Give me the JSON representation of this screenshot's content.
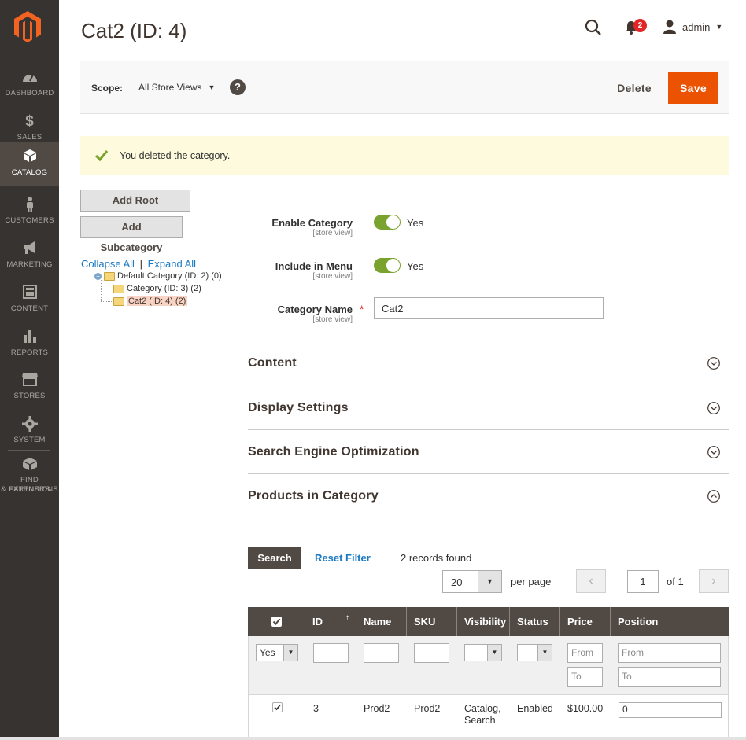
{
  "sidebar": {
    "items": [
      {
        "label": "DASHBOARD",
        "icon": "dashboard-icon"
      },
      {
        "label": "SALES",
        "icon": "dollar-icon"
      },
      {
        "label": "CATALOG",
        "icon": "cube-icon",
        "active": true
      },
      {
        "label": "CUSTOMERS",
        "icon": "person-icon"
      },
      {
        "label": "MARKETING",
        "icon": "megaphone-icon"
      },
      {
        "label": "CONTENT",
        "icon": "content-icon"
      },
      {
        "label": "REPORTS",
        "icon": "bar-chart-icon"
      },
      {
        "label": "STORES",
        "icon": "store-icon"
      },
      {
        "label": "SYSTEM",
        "icon": "gear-icon"
      }
    ],
    "partners_line1": "FIND PARTNERS",
    "partners_line2": "& EXTENSIONS"
  },
  "header": {
    "title": "Cat2 (ID: 4)",
    "notification_count": "2",
    "user_name": "admin"
  },
  "scope": {
    "label": "Scope:",
    "value": "All Store Views",
    "help": "?",
    "delete_label": "Delete",
    "save_label": "Save"
  },
  "message": {
    "text": "You deleted the category."
  },
  "tree": {
    "add_root": "Add Root Category",
    "add_sub": "Add Subcategory",
    "collapse_all": "Collapse All",
    "separator": "|",
    "expand_all": "Expand All",
    "nodes": [
      "Default Category (ID: 2) (0)",
      "Category (ID: 3) (2)",
      "Cat2 (ID: 4) (2)"
    ]
  },
  "form": {
    "enable_label": "Enable Category",
    "enable_scope": "[store view]",
    "enable_value": "Yes",
    "menu_label": "Include in Menu",
    "menu_scope": "[store view]",
    "menu_value": "Yes",
    "name_label": "Category Name",
    "name_scope": "[store view]",
    "name_required": "*",
    "name_value": "Cat2"
  },
  "sections": [
    {
      "title": "Content",
      "expanded": false
    },
    {
      "title": "Display Settings",
      "expanded": false
    },
    {
      "title": "Search Engine Optimization",
      "expanded": false
    },
    {
      "title": "Products in Category",
      "expanded": true
    }
  ],
  "grid": {
    "search_label": "Search",
    "reset_label": "Reset Filter",
    "records": "2 records found",
    "per_page_value": "20",
    "per_page_label": "per page",
    "page_value": "1",
    "page_of": "of 1",
    "columns": [
      "ID",
      "Name",
      "SKU",
      "Visibility",
      "Status",
      "Price",
      "Position"
    ],
    "filters": {
      "in_category": "Yes",
      "price_from": "From",
      "price_to": "To",
      "pos_from": "From",
      "pos_to": "To"
    },
    "rows": [
      {
        "id": "3",
        "name": "Prod2",
        "sku": "Prod2",
        "visibility_1": "Catalog,",
        "visibility_2": "Search",
        "status": "Enabled",
        "price": "$100.00",
        "position": "0"
      }
    ]
  },
  "colors": {
    "accent": "#eb5202",
    "sidebar_bg": "#373330",
    "link": "#1979c3",
    "toggle_on": "#79a22e"
  }
}
